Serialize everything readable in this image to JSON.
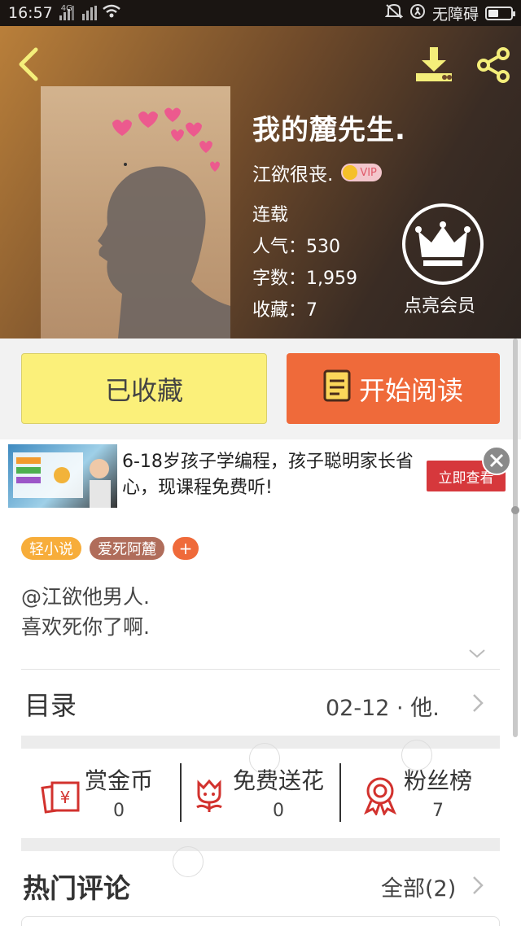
{
  "status_bar": {
    "time": "16:57",
    "network": "4G",
    "carrier": "无障碍"
  },
  "book": {
    "title": "我的麓先生.",
    "author": "江欲很丧.",
    "vip_badge": "VIP",
    "status": "连载",
    "popularity": "人气：530",
    "word_count": "字数：1,959",
    "favorites": "收藏：7",
    "membership_label": "点亮会员"
  },
  "actions": {
    "favorited_label": "已收藏",
    "read_label": "开始阅读"
  },
  "ad": {
    "text": "6-18岁孩子学编程，孩子聪明家长省心，现课程免费听!",
    "button": "立即查看"
  },
  "tags": [
    "轻小说",
    "爱死阿麓"
  ],
  "tag_add": "+",
  "intro": [
    "@江欲他男人.",
    "喜欢死你了啊."
  ],
  "toc": {
    "label": "目录",
    "value": "02-12 · 他."
  },
  "gifts": [
    {
      "label": "赏金币",
      "value": "0",
      "icon": "coin-reward-icon"
    },
    {
      "label": "免费送花",
      "value": "0",
      "icon": "flower-icon"
    },
    {
      "label": "粉丝榜",
      "value": "7",
      "icon": "medal-icon"
    }
  ],
  "comments": {
    "label": "热门评论",
    "all": "全部(2)"
  },
  "colors": {
    "accent_orange": "#ef6a3a",
    "fav_yellow": "#fbf07a",
    "tag_yellow": "#f7ad3a",
    "tag_brown": "#b06d5b",
    "ad_red": "#d6383c"
  }
}
